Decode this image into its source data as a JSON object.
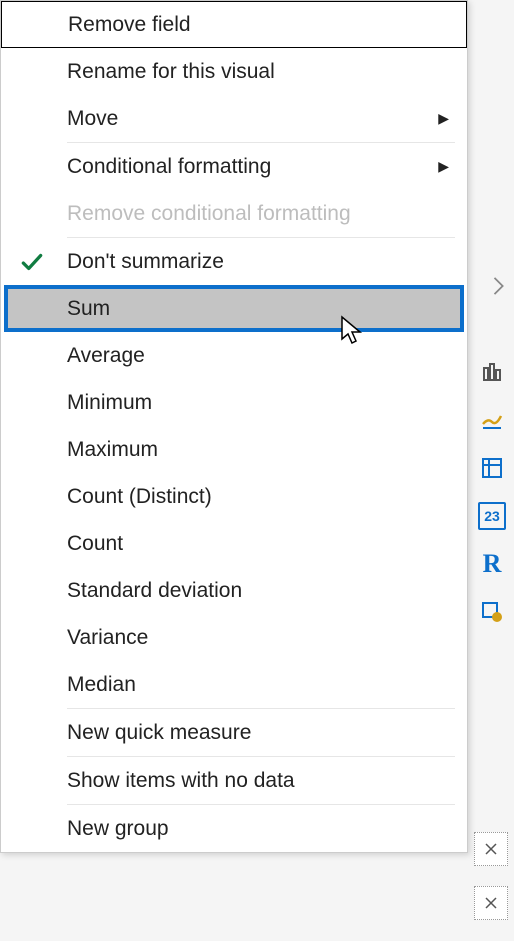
{
  "menu": {
    "removeField": "Remove field",
    "renameVisual": "Rename for this visual",
    "move": "Move",
    "conditionalFormatting": "Conditional formatting",
    "removeConditionalFormatting": "Remove conditional formatting",
    "dontSummarize": "Don't summarize",
    "sum": "Sum",
    "average": "Average",
    "minimum": "Minimum",
    "maximum": "Maximum",
    "countDistinct": "Count (Distinct)",
    "count": "Count",
    "standardDeviation": "Standard deviation",
    "variance": "Variance",
    "median": "Median",
    "newQuickMeasure": "New quick measure",
    "showItemsNoData": "Show items with no data",
    "newGroup": "New group"
  },
  "side": {
    "icon1": "▯▯",
    "icon2": "≈",
    "icon3": "⊞",
    "icon4": "23",
    "icon5": "R",
    "icon6": "▣"
  }
}
